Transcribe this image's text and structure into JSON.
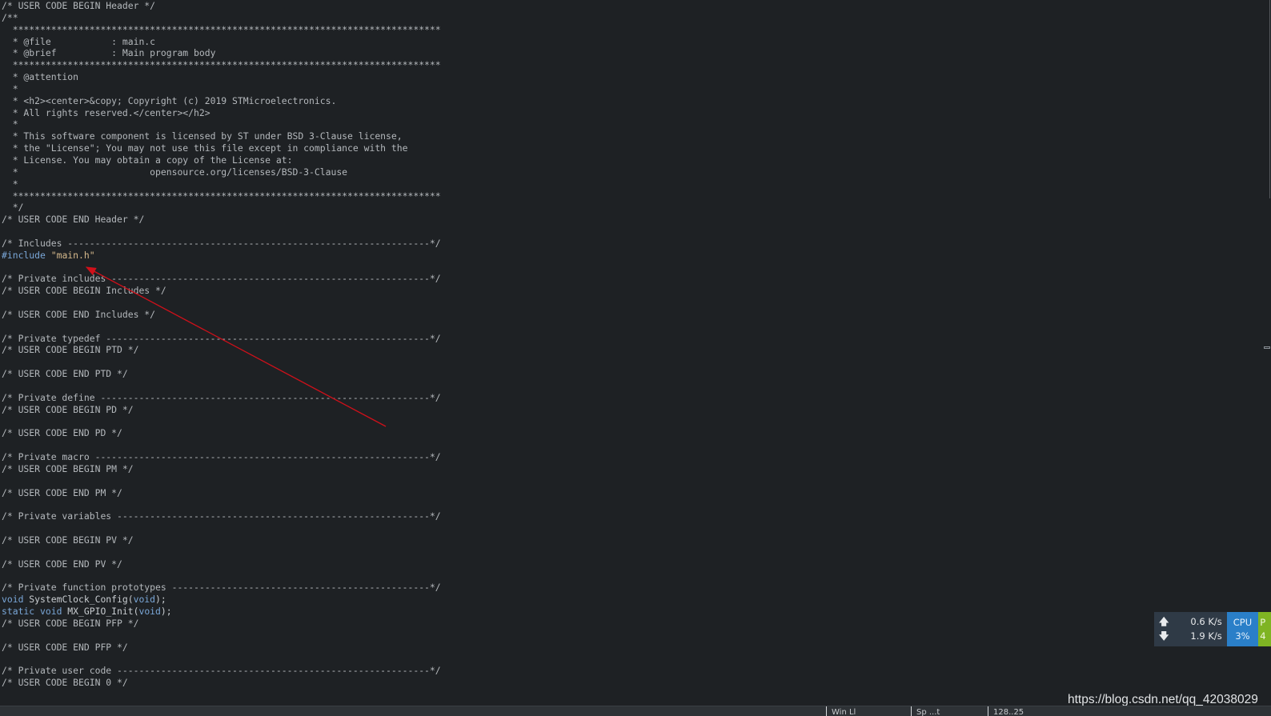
{
  "editor": {
    "lines": [
      [
        [
          "comment",
          "/* USER CODE BEGIN Header */"
        ]
      ],
      [
        [
          "comment",
          "/**"
        ]
      ],
      [
        [
          "comment",
          "  ******************************************************************************"
        ]
      ],
      [
        [
          "comment",
          "  * @file           : main.c"
        ]
      ],
      [
        [
          "comment",
          "  * @brief          : Main program body"
        ]
      ],
      [
        [
          "comment",
          "  ******************************************************************************"
        ]
      ],
      [
        [
          "comment",
          "  * @attention"
        ]
      ],
      [
        [
          "comment",
          "  *"
        ]
      ],
      [
        [
          "comment",
          "  * <h2><center>&copy; Copyright (c) 2019 STMicroelectronics."
        ]
      ],
      [
        [
          "comment",
          "  * All rights reserved.</center></h2>"
        ]
      ],
      [
        [
          "comment",
          "  *"
        ]
      ],
      [
        [
          "comment",
          "  * This software component is licensed by ST under BSD 3-Clause license,"
        ]
      ],
      [
        [
          "comment",
          "  * the \"License\"; You may not use this file except in compliance with the"
        ]
      ],
      [
        [
          "comment",
          "  * License. You may obtain a copy of the License at:"
        ]
      ],
      [
        [
          "comment",
          "  *                        opensource.org/licenses/BSD-3-Clause"
        ]
      ],
      [
        [
          "comment",
          "  *"
        ]
      ],
      [
        [
          "comment",
          "  ******************************************************************************"
        ]
      ],
      [
        [
          "comment",
          "  */"
        ]
      ],
      [
        [
          "comment",
          "/* USER CODE END Header */"
        ]
      ],
      [],
      [
        [
          "comment",
          "/* Includes ------------------------------------------------------------------*/"
        ]
      ],
      [
        [
          "kw",
          "#include"
        ],
        [
          "plain",
          " "
        ],
        [
          "str",
          "\"main.h\""
        ]
      ],
      [],
      [
        [
          "comment",
          "/* Private includes ----------------------------------------------------------*/"
        ]
      ],
      [
        [
          "comment",
          "/* USER CODE BEGIN Includes */"
        ]
      ],
      [],
      [
        [
          "comment",
          "/* USER CODE END Includes */"
        ]
      ],
      [],
      [
        [
          "comment",
          "/* Private typedef -----------------------------------------------------------*/"
        ]
      ],
      [
        [
          "comment",
          "/* USER CODE BEGIN PTD */"
        ]
      ],
      [],
      [
        [
          "comment",
          "/* USER CODE END PTD */"
        ]
      ],
      [],
      [
        [
          "comment",
          "/* Private define ------------------------------------------------------------*/"
        ]
      ],
      [
        [
          "comment",
          "/* USER CODE BEGIN PD */"
        ]
      ],
      [],
      [
        [
          "comment",
          "/* USER CODE END PD */"
        ]
      ],
      [],
      [
        [
          "comment",
          "/* Private macro -------------------------------------------------------------*/"
        ]
      ],
      [
        [
          "comment",
          "/* USER CODE BEGIN PM */"
        ]
      ],
      [],
      [
        [
          "comment",
          "/* USER CODE END PM */"
        ]
      ],
      [],
      [
        [
          "comment",
          "/* Private variables ---------------------------------------------------------*/"
        ]
      ],
      [],
      [
        [
          "comment",
          "/* USER CODE BEGIN PV */"
        ]
      ],
      [],
      [
        [
          "comment",
          "/* USER CODE END PV */"
        ]
      ],
      [],
      [
        [
          "comment",
          "/* Private function prototypes -----------------------------------------------*/"
        ]
      ],
      [
        [
          "kw",
          "void"
        ],
        [
          "plain",
          " SystemClock_Config("
        ],
        [
          "kw",
          "void"
        ],
        [
          "plain",
          ");"
        ]
      ],
      [
        [
          "kw",
          "static"
        ],
        [
          "plain",
          " "
        ],
        [
          "kw",
          "void"
        ],
        [
          "plain",
          " MX_GPIO_Init("
        ],
        [
          "kw",
          "void"
        ],
        [
          "plain",
          ");"
        ]
      ],
      [
        [
          "comment",
          "/* USER CODE BEGIN PFP */"
        ]
      ],
      [],
      [
        [
          "comment",
          "/* USER CODE END PFP */"
        ]
      ],
      [],
      [
        [
          "comment",
          "/* Private user code ---------------------------------------------------------*/"
        ]
      ],
      [
        [
          "comment",
          "/* USER CODE BEGIN 0 */"
        ]
      ]
    ]
  },
  "annotation": {
    "arrow_color": "#d0101a"
  },
  "net_monitor": {
    "upload_icon": "arrow-up-icon",
    "download_icon": "arrow-down-icon",
    "upload_speed": "0.6 K/s",
    "download_speed": "1.9 K/s",
    "cpu_label": "CPU",
    "cpu_value": "3%",
    "mem_label": "P",
    "mem_value": "4"
  },
  "watermark": {
    "text": "https://blog.csdn.net/qq_42038029"
  },
  "statusbar": {
    "segment_1": "Win Ll",
    "segment_2": "Sp  ...t",
    "segment_3": "128..25"
  },
  "colors": {
    "background": "#1e2124",
    "comment": "#b4b8bc",
    "keyword": "#7aa7d8",
    "string": "#d6b98c",
    "cpu_box": "#2a7fc8",
    "mem_box": "#7fb423",
    "net_box": "#2f3a46"
  }
}
